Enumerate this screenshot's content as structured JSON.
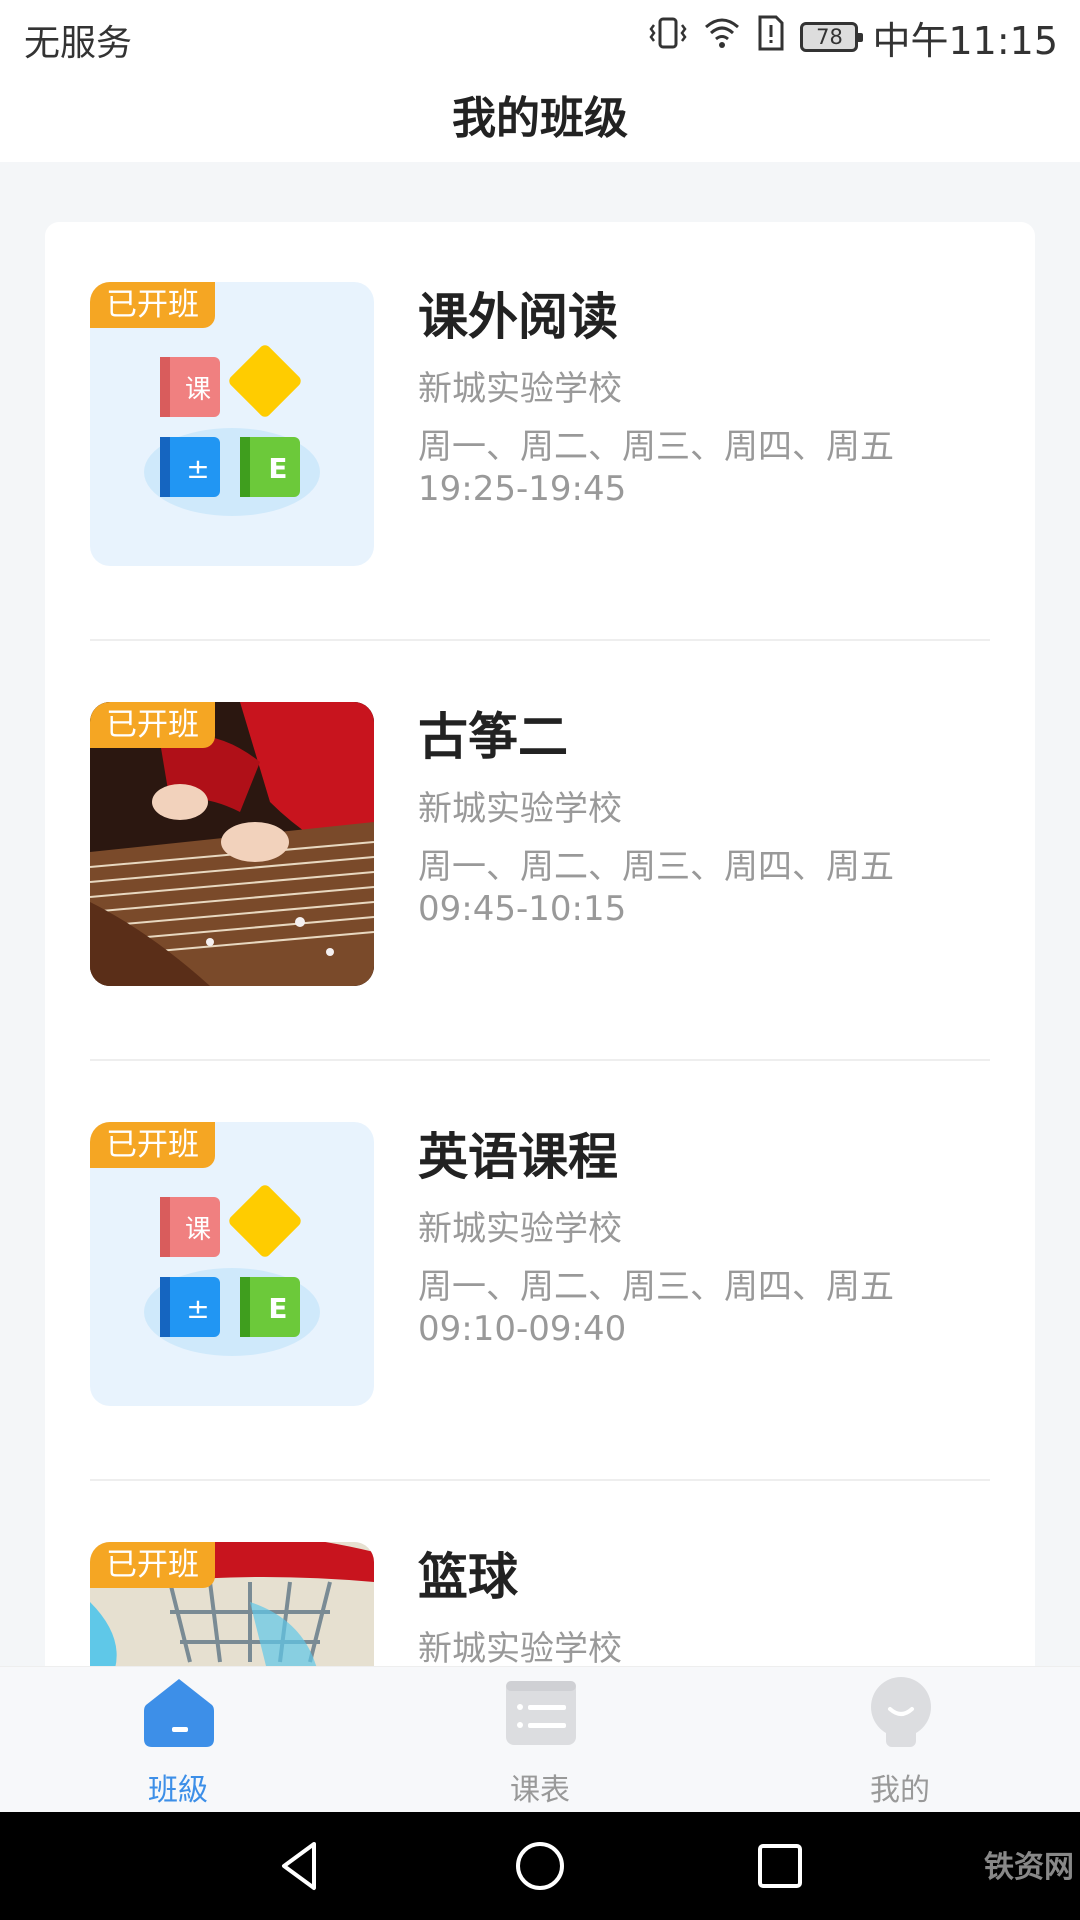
{
  "status_bar": {
    "carrier": "无服务",
    "battery": "78",
    "time": "中午11:15"
  },
  "header": {
    "title": "我的班级"
  },
  "classes": [
    {
      "badge": "已开班",
      "title": "课外阅读",
      "school": "新城实验学校",
      "days": "周一、周二、周三、周四、周五",
      "time": "19:25-19:45",
      "image": "books-illustration"
    },
    {
      "badge": "已开班",
      "title": "古筝二",
      "school": "新城实验学校",
      "days": "周一、周二、周三、周四、周五",
      "time": "09:45-10:15",
      "image": "guzheng-photo"
    },
    {
      "badge": "已开班",
      "title": "英语课程",
      "school": "新城实验学校",
      "days": "周一、周二、周三、周四、周五",
      "time": "09:10-09:40",
      "image": "books-illustration"
    },
    {
      "badge": "已开班",
      "title": "篮球",
      "school": "新城实验学校",
      "image": "basketball-hoop-photo"
    }
  ],
  "books_icon_labels": {
    "book_red": "课",
    "book_blue": "±",
    "book_green": "E"
  },
  "tab_bar": {
    "tabs": [
      {
        "label": "班級",
        "icon": "home-icon",
        "active": true
      },
      {
        "label": "课表",
        "icon": "schedule-icon",
        "active": false
      },
      {
        "label": "我的",
        "icon": "profile-icon",
        "active": false
      }
    ]
  },
  "colors": {
    "accent": "#3d8fe8",
    "badge": "#f5a623",
    "inactive_icon": "#dcdde0"
  },
  "watermark": "铁资网"
}
